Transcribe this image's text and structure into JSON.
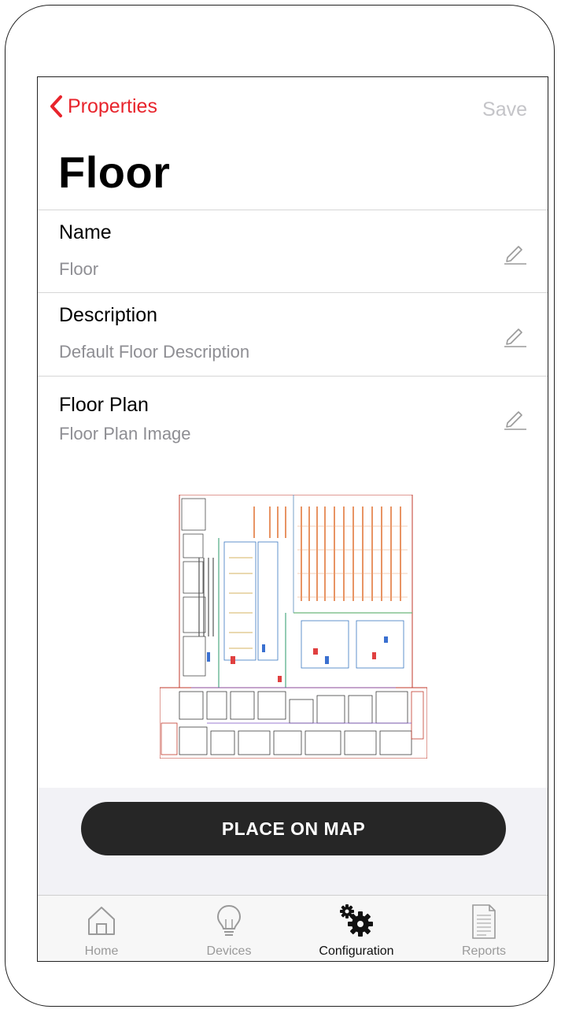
{
  "nav": {
    "back_label": "Properties",
    "save_label": "Save"
  },
  "page": {
    "title": "Floor"
  },
  "fields": [
    {
      "label": "Name",
      "value": "Floor"
    },
    {
      "label": "Description",
      "value": "Default Floor Description"
    },
    {
      "label": "Floor Plan",
      "value": "Floor Plan Image"
    }
  ],
  "action": {
    "place_label": "PLACE ON MAP"
  },
  "tabs": [
    {
      "label": "Home",
      "icon": "home-icon",
      "active": false
    },
    {
      "label": "Devices",
      "icon": "lightbulb-icon",
      "active": false
    },
    {
      "label": "Configuration",
      "icon": "gears-icon",
      "active": true
    },
    {
      "label": "Reports",
      "icon": "document-icon",
      "active": false
    }
  ],
  "colors": {
    "accent": "#e8242c",
    "button": "#262626",
    "muted": "#8e8e93"
  }
}
